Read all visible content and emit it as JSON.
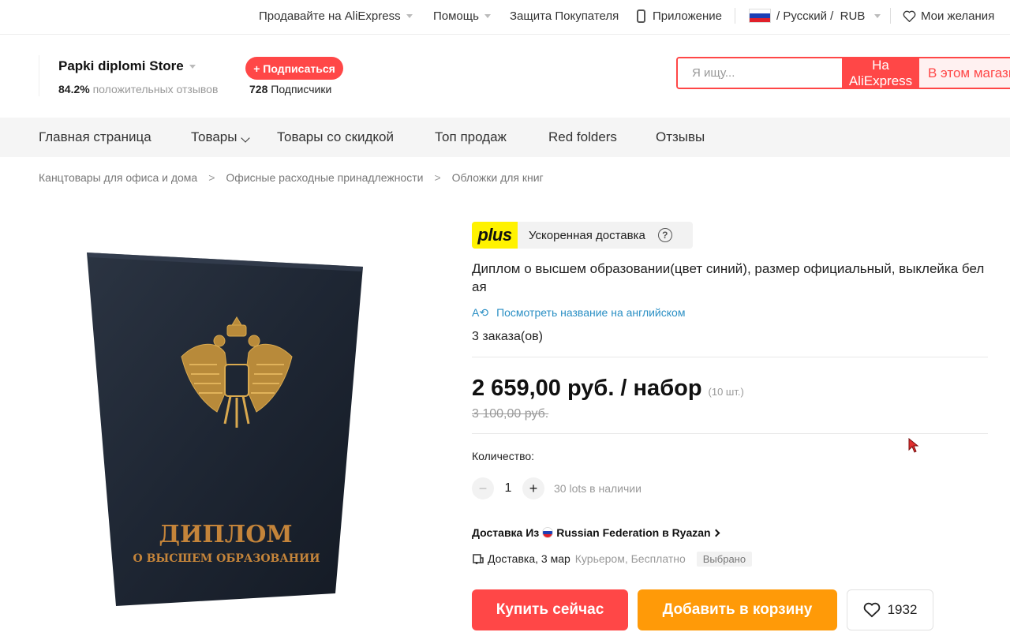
{
  "topbar": {
    "sell": "Продавайте на AliExpress",
    "help": "Помощь",
    "protection": "Защита Покупателя",
    "app": "Приложение",
    "language": "/ Русский /",
    "currency": "RUB",
    "wishlist": "Мои желания"
  },
  "store": {
    "name": "Papki diplomi Store",
    "rating_value": "84.2%",
    "rating_label": "положительных отзывов",
    "subscribe": "+ Подписаться",
    "subscribers_count": "728",
    "subscribers_label": "Подписчики"
  },
  "search": {
    "placeholder": "Я ищу...",
    "btn_aliexpress": "На AliExpress",
    "btn_store": "В этом магазине"
  },
  "nav": {
    "home": "Главная страница",
    "products": "Товары",
    "discount": "Товары со скидкой",
    "top": "Топ продаж",
    "red_folders": "Red folders",
    "reviews": "Отзывы"
  },
  "breadcrumb": [
    "Канцтовары для офиса и дома",
    "Офисные расходные принадлежности",
    "Обложки для книг"
  ],
  "product": {
    "cover_line1": "ДИПЛОМ",
    "cover_line2": "О ВЫСШЕМ ОБРАЗОВАНИИ",
    "plus_logo": "plus",
    "plus_text": "Ускоренная доставка",
    "title": "Диплом о высшем образовании(цвет синий), размер официальный, выклейка белая",
    "translate": "Посмотреть название на английском",
    "orders": "3 заказа(ов)",
    "price": "2 659,00 руб. / набор",
    "price_unit": "(10 шт.)",
    "old_price": "3 100,00 руб.",
    "qty_label": "Количество:",
    "qty_value": "1",
    "stock": "30 lots в наличии",
    "delivery_prefix": "Доставка Из",
    "delivery_suffix": "Russian Federation в Ryazan",
    "ship_date": "Доставка, 3 мар",
    "ship_method": "Курьером, Бесплатно",
    "chosen": "Выбрано",
    "buy": "Купить сейчас",
    "cart": "Добавить в корзину",
    "wish_count": "1932"
  },
  "colors": {
    "accent": "#ff4747",
    "cart": "#ff9a08",
    "plus": "#fff200",
    "link": "#2a8fc4"
  }
}
